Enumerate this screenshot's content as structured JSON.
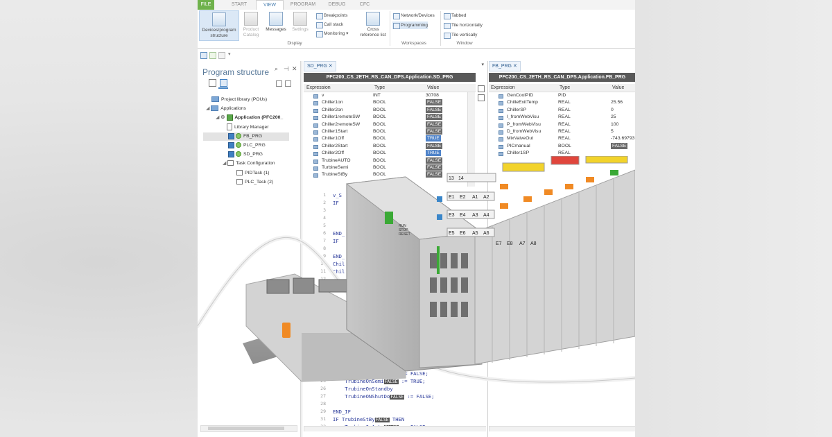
{
  "ribbon": {
    "tabs": [
      {
        "label": "FILE"
      },
      {
        "label": "START"
      },
      {
        "label": "VIEW"
      },
      {
        "label": "PROGRAM"
      },
      {
        "label": "DEBUG"
      },
      {
        "label": "CFC"
      }
    ],
    "display": {
      "devices_line1": "Devices/program",
      "devices_line2": "structure",
      "product_line1": "Product",
      "product_line2": "Catalog",
      "messages": "Messages",
      "settings": "Settings",
      "breakpoints": "Breakpoints",
      "callstack": "Call stack",
      "monitoring": "Monitoring",
      "crossref_line1": "Cross",
      "crossref_line2": "reference list",
      "group": "Display"
    },
    "workspaces": {
      "network": "Network/Devices",
      "programming": "Programming",
      "group": "Workspaces"
    },
    "window": {
      "tabbed": "Tabbed",
      "tile_h": "Tile horizontally",
      "tile_v": "Tile vertically",
      "group": "Window"
    }
  },
  "program_structure": {
    "title": "Program structure",
    "tree": {
      "project_library": "Project library (POUs)",
      "applications": "Applications",
      "application": "Application (PFC200_",
      "library_manager": "Library Manager",
      "fb_prg": "FB_PRG",
      "plc_prg": "PLC_PRG",
      "sd_prg": "SD_PRG",
      "task_config": "Task Configuration",
      "pid_task": "PIDTask (1)",
      "plc_task": "PLC_Task (2)"
    }
  },
  "sd_pane": {
    "tab": "SD_PRG",
    "title": "PFC200_CS_2ETH_RS_CAN_DPS.Application.SD_PRG",
    "headers": {
      "expression": "Expression",
      "type": "Type",
      "value": "Value"
    },
    "rows": [
      {
        "expression": "v",
        "type": "INT",
        "value": "30708",
        "style": "plain"
      },
      {
        "expression": "Chiller1on",
        "type": "BOOL",
        "value": "FALSE",
        "style": "false"
      },
      {
        "expression": "Chiller2on",
        "type": "BOOL",
        "value": "FALSE",
        "style": "false"
      },
      {
        "expression": "Chiller1remoteSW",
        "type": "BOOL",
        "value": "FALSE",
        "style": "false"
      },
      {
        "expression": "Chiller2remoteSW",
        "type": "BOOL",
        "value": "FALSE",
        "style": "false"
      },
      {
        "expression": "Chiller1Start",
        "type": "BOOL",
        "value": "FALSE",
        "style": "false"
      },
      {
        "expression": "Chiller1Off",
        "type": "BOOL",
        "value": "TRUE",
        "style": "true"
      },
      {
        "expression": "Chiller2Start",
        "type": "BOOL",
        "value": "FALSE",
        "style": "false"
      },
      {
        "expression": "Chiller2Off",
        "type": "BOOL",
        "value": "TRUE",
        "style": "true"
      },
      {
        "expression": "TrubineAUTO",
        "type": "BOOL",
        "value": "FALSE",
        "style": "false"
      },
      {
        "expression": "TurbineSemi",
        "type": "BOOL",
        "value": "FALSE",
        "style": "false"
      },
      {
        "expression": "TrubineStBy",
        "type": "BOOL",
        "value": "FALSE",
        "style": "false"
      }
    ],
    "code_top": [
      {
        "ln": "1",
        "text": "v_S"
      },
      {
        "ln": "2",
        "text": "IF "
      },
      {
        "ln": "3",
        "text": ""
      },
      {
        "ln": "4",
        "text": ""
      },
      {
        "ln": "5",
        "text": ""
      },
      {
        "ln": "6",
        "text": "END_"
      },
      {
        "ln": "7",
        "text": "IF "
      },
      {
        "ln": "8",
        "text": ""
      },
      {
        "ln": "9",
        "text": "END_"
      },
      {
        "ln": "10",
        "text": "Chil"
      },
      {
        "ln": "11",
        "text": "Chil"
      },
      {
        "ln": "12",
        "text": ""
      }
    ],
    "code_bottom": [
      {
        "ln": "24",
        "pre": "    TrubineOnAuto",
        "val": "FALSE",
        "post": " := FALSE;"
      },
      {
        "ln": "25",
        "pre": "    TrubineOnSemi",
        "val": "FALSE",
        "post": " := TRUE;"
      },
      {
        "ln": "26",
        "pre": "    TrubineOnStandby",
        "val": "",
        "post": ""
      },
      {
        "ln": "27",
        "pre": "    TrubineONShutDo",
        "val": "FALSE",
        "post": " := FALSE;"
      },
      {
        "ln": "28",
        "pre": "",
        "val": "",
        "post": ""
      },
      {
        "ln": "29",
        "pre": "END_IF",
        "val": "",
        "post": ""
      },
      {
        "ln": "31",
        "pre": "IF TrubineStBy",
        "val": "FALSE",
        "post": " THEN"
      },
      {
        "ln": "32",
        "pre": "    TrubineOnAuto",
        "val": "FALSE",
        "post": " := FALSE;"
      }
    ]
  },
  "fb_pane": {
    "tab": "FB_PRG",
    "title": "PFC200_CS_2ETH_RS_CAN_DPS.Application.FB_PRG",
    "headers": {
      "expression": "Expression",
      "type": "Type",
      "value": "Value"
    },
    "rows": [
      {
        "expression": "GenCoolPID",
        "type": "PID",
        "value": "",
        "style": "plain"
      },
      {
        "expression": "ChilleExitTemp",
        "type": "REAL",
        "value": "25.56",
        "style": "plain"
      },
      {
        "expression": "ChillerSP",
        "type": "REAL",
        "value": "0",
        "style": "plain"
      },
      {
        "expression": "I_fromWebVisu",
        "type": "REAL",
        "value": "25",
        "style": "plain"
      },
      {
        "expression": "P_fromWebVisu",
        "type": "REAL",
        "value": "100",
        "style": "plain"
      },
      {
        "expression": "D_fromWebVisu",
        "type": "REAL",
        "value": "5",
        "style": "plain"
      },
      {
        "expression": "MixValveOut",
        "type": "REAL",
        "value": "-743.69793",
        "style": "plain"
      },
      {
        "expression": "PICmanual",
        "type": "BOOL",
        "value": "FALSE",
        "style": "false"
      },
      {
        "expression": "Chiller1SP",
        "type": "REAL",
        "value": "",
        "style": "plain"
      }
    ]
  },
  "hardware": {
    "led_labels": [
      "RUN",
      "STOP",
      "RESET"
    ],
    "terminal_tags": [
      "13",
      "14",
      "E1",
      "E2",
      "A1",
      "A2",
      "E3",
      "E4",
      "A3",
      "A4",
      "E5",
      "E6",
      "A5",
      "A6",
      "E7",
      "E8",
      "A7",
      "A8"
    ]
  },
  "colors": {
    "file_tab": "#6fb24c",
    "pane_header": "#595959",
    "false_badge": "#6b6b6b",
    "true_badge": "#4f83c9",
    "controller_green": "#3aa935",
    "terminal_orange": "#f08a24",
    "terminal_yellow": "#f2d32b",
    "terminal_red": "#e0463c"
  }
}
